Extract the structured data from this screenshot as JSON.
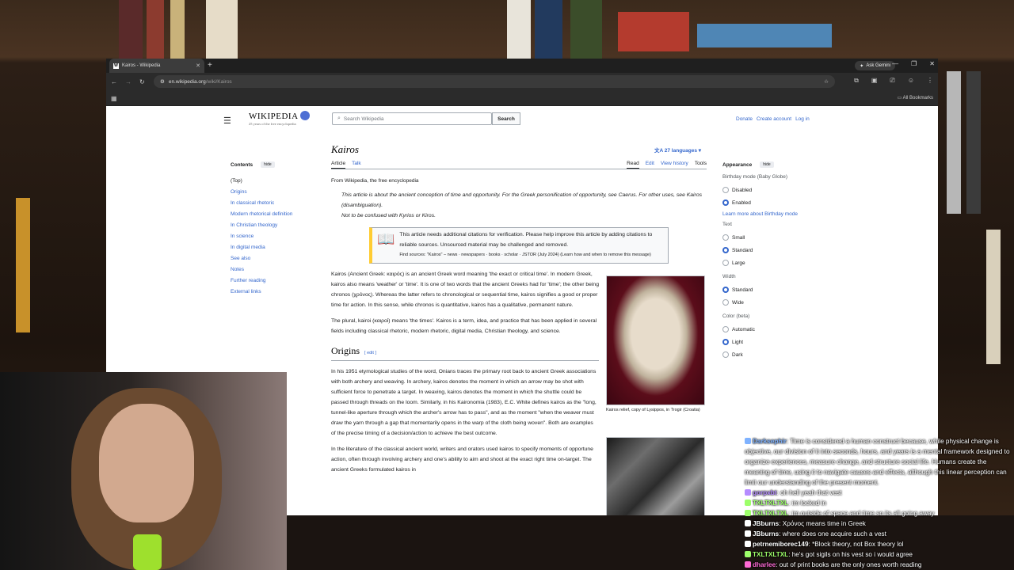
{
  "browser": {
    "tab_title": "Kairos - Wikipedia",
    "tab_favicon": "W",
    "new_tab": "+",
    "ask_gemini": "Ask Gemini",
    "url_host": "en.wikipedia.org",
    "url_path": "/wiki/Kairos",
    "all_bookmarks": "All Bookmarks"
  },
  "wiki": {
    "logo_name": "WIKIPEDIA",
    "logo_tagline": "25 years of the free encyclopedia",
    "search_placeholder": "Search Wikipedia",
    "search_button": "Search",
    "top_links": [
      "Donate",
      "Create account",
      "Log in"
    ],
    "contents_title": "Contents",
    "hide": "hide",
    "toc": [
      "(Top)",
      "Origins",
      "In classical rhetoric",
      "Modern rhetorical definition",
      "In Christian theology",
      "In science",
      "In digital media",
      "See also",
      "Notes",
      "Further reading",
      "External links"
    ],
    "page_title": "Kairos",
    "languages": "27 languages",
    "tabs_left": [
      "Article",
      "Talk"
    ],
    "tabs_right": [
      "Read",
      "Edit",
      "View history",
      "Tools"
    ],
    "from": "From Wikipedia, the free encyclopedia",
    "hatnote": "This article is about the ancient conception of time and opportunity. For the Greek personification of opportunity, see Caerus. For other uses, see Kairos (disambiguation).",
    "hatnote2": "Not to be confused with Kyrios or Kiros.",
    "ambox": "This article needs additional citations for verification. Please help improve this article by adding citations to reliable sources. Unsourced material may be challenged and removed.",
    "ambox_small": "Find sources: \"Kairos\" – news · newspapers · books · scholar · JSTOR (July 2024) (Learn how and when to remove this message)",
    "para1": "Kairos (Ancient Greek: καιρός) is an ancient Greek word meaning 'the exact or critical time'. In modern Greek, kairos also means 'weather' or 'time'. It is one of two words that the ancient Greeks had for 'time'; the other being chronos (χρόνος). Whereas the latter refers to chronological or sequential time, kairos signifies a good or proper time for action. In this sense, while chronos is quantitative, kairos has a qualitative, permanent nature.",
    "para2": "The plural, kairoi (καιροί) means 'the times'. Kairos is a term, idea, and practice that has been applied in several fields including classical rhetoric, modern rhetoric, digital media, Christian theology, and science.",
    "h_origins": "Origins",
    "edit": "edit",
    "para3": "In his 1951 etymological studies of the word, Onians traces the primary root back to ancient Greek associations with both archery and weaving. In archery, kairos denotes the moment in which an arrow may be shot with sufficient force to penetrate a target. In weaving, kairos denotes the moment in which the shuttle could be passed through threads on the loom. Similarly, in his Kaironomia (1983), E.C. White defines kairos as the \"long, tunnel-like aperture through which the archer's arrow has to pass\", and as the moment \"when the weaver must draw the yarn through a gap that momentarily opens in the warp of the cloth being woven\". Both are examples of the precise timing of a decision/action to achieve the best outcome.",
    "para4": "In the literature of the classical ancient world, writers and orators used kairos to specify moments of opportune action, often through involving archery and one's ability to aim and shoot at the exact right time on-target. The ancient Greeks formulated kairos in",
    "caption": "Kairos relief, copy of Lysippos, in Trogir (Croatia)",
    "appearance": {
      "title": "Appearance",
      "birthday_label": "Birthday mode (Baby Globe)",
      "birthday": [
        {
          "label": "Disabled",
          "on": false
        },
        {
          "label": "Enabled",
          "on": true
        }
      ],
      "birthday_link": "Learn more about Birthday mode",
      "text_label": "Text",
      "text": [
        {
          "label": "Small",
          "on": false
        },
        {
          "label": "Standard",
          "on": true
        },
        {
          "label": "Large",
          "on": false
        }
      ],
      "width_label": "Width",
      "width": [
        {
          "label": "Standard",
          "on": true
        },
        {
          "label": "Wide",
          "on": false
        }
      ],
      "color_label": "Color (beta)",
      "color": [
        {
          "label": "Automatic",
          "on": false
        },
        {
          "label": "Light",
          "on": true
        },
        {
          "label": "Dark",
          "on": false
        }
      ]
    }
  },
  "chat": [
    {
      "user": "Darksephir",
      "color": "#7fb2ff",
      "text": "Time is considered a human construct because, while physical change is objective, our division of it into seconds, hours, and years is a mental framework designed to organize experiences, measure change, and structure social life. Humans create the meaning of time, using it to navigate causes and effects, although this linear perception can limit our understanding of the present moment."
    },
    {
      "user": "gorpxbt",
      "color": "#b58cff",
      "text": "oh hell yeah that vest"
    },
    {
      "user": "TXLTXLTXL",
      "color": "#9dff6a",
      "text": "im locked in"
    },
    {
      "user": "TXLTXLTXL",
      "color": "#9dff6a",
      "text": "im outside of space and time so its all going away"
    },
    {
      "user": "JBburns",
      "color": "#ffffff",
      "text": "Χρόνος means time in Greek"
    },
    {
      "user": "JBburns",
      "color": "#ffffff",
      "text": "where does one acquire such a vest"
    },
    {
      "user": "petrnemiborec149",
      "color": "#ffffff",
      "text": "*Block theory, not Box theory lol"
    },
    {
      "user": "TXLTXLTXL",
      "color": "#9dff6a",
      "text": "he's got sigils on his vest so i would agree"
    },
    {
      "user": "dharlee",
      "color": "#ff6ad5",
      "text": "out of print books are the only ones worth reading"
    }
  ]
}
